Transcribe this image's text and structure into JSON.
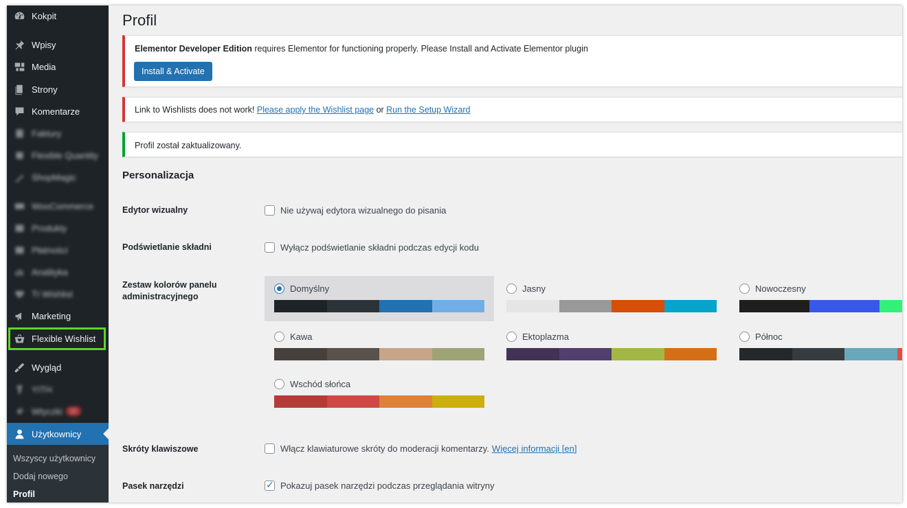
{
  "sidebar": {
    "items": [
      {
        "key": "kokpit",
        "label": "Kokpit",
        "icon": "dashboard-icon",
        "blurred": false
      },
      {
        "key": "wpisy",
        "label": "Wpisy",
        "icon": "pin-icon",
        "blurred": false
      },
      {
        "key": "media",
        "label": "Media",
        "icon": "media-icon",
        "blurred": false
      },
      {
        "key": "strony",
        "label": "Strony",
        "icon": "pages-icon",
        "blurred": false
      },
      {
        "key": "komentarze",
        "label": "Komentarze",
        "icon": "comment-icon",
        "blurred": false
      },
      {
        "key": "faktury",
        "label": "Faktury",
        "icon": "invoice-icon",
        "blurred": true
      },
      {
        "key": "flexible-quantity",
        "label": "Flexible Quantity",
        "icon": "quantity-icon",
        "blurred": true
      },
      {
        "key": "shopmagic",
        "label": "ShopMagic",
        "icon": "magic-icon",
        "blurred": true
      },
      {
        "key": "woocommerce",
        "label": "WooCommerce",
        "icon": "woo-icon",
        "blurred": true
      },
      {
        "key": "produkty",
        "label": "Produkty",
        "icon": "product-icon",
        "blurred": true
      },
      {
        "key": "platnosci",
        "label": "Płatności",
        "icon": "payment-icon",
        "blurred": true
      },
      {
        "key": "analityka",
        "label": "Analityka",
        "icon": "analytics-icon",
        "blurred": true
      },
      {
        "key": "ti-wishlist",
        "label": "TI Wishlist",
        "icon": "heart-icon",
        "blurred": true
      },
      {
        "key": "marketing",
        "label": "Marketing",
        "icon": "megaphone-icon",
        "blurred": false
      },
      {
        "key": "flexible-wishlist",
        "label": "Flexible Wishlist",
        "icon": "basket-heart-icon",
        "blurred": false
      },
      {
        "key": "wyglad",
        "label": "Wygląd",
        "icon": "brush-icon",
        "blurred": false
      },
      {
        "key": "wtyczki-hidden",
        "label": "YITH",
        "icon": "plugin-icon",
        "blurred": true
      },
      {
        "key": "wtyczki",
        "label": "Wtyczki",
        "icon": "plug-icon",
        "blurred": true,
        "badge": "10"
      },
      {
        "key": "uzytkownicy",
        "label": "Użytkownicy",
        "icon": "users-icon",
        "blurred": false,
        "current": true
      }
    ],
    "submenu": [
      "Wszyscy użytkownicy",
      "Dodaj nowego",
      "Profil"
    ]
  },
  "main": {
    "title": "Profil",
    "notice_elementor": {
      "bold": "Elementor Developer Edition",
      "text": " requires Elementor for functioning properly. Please Install and Activate Elementor plugin",
      "button": "Install & Activate"
    },
    "notice_wishlist": {
      "text": "Link to Wishlists does not work! ",
      "link1": "Please apply the Wishlist page",
      "or": " or ",
      "link2": "Run the Setup Wizard"
    },
    "notice_success": "Profil został zaktualizowany.",
    "section_title": "Personalizacja",
    "visual_editor": {
      "label": "Edytor wizualny",
      "option": "Nie używaj edytora wizualnego do pisania",
      "checked": false
    },
    "syntax": {
      "label": "Podświetlanie składni",
      "option": "Wyłącz podświetlanie składni podczas edycji kodu",
      "checked": false
    },
    "color_scheme": {
      "label": "Zestaw kolorów panelu administracyjnego",
      "schemes": [
        {
          "name": "Domyślny",
          "selected": true,
          "colors": [
            "#1d2327",
            "#2c3338",
            "#2271b1",
            "#72aee6"
          ]
        },
        {
          "name": "Jasny",
          "selected": false,
          "colors": [
            "#e5e5e5",
            "#999999",
            "#d64e07",
            "#04a4cc"
          ]
        },
        {
          "name": "Nowoczesny",
          "selected": false,
          "colors": [
            "#1e1e1e",
            "#3858e9",
            "#33f078"
          ]
        },
        {
          "name": "Kawa",
          "selected": false,
          "colors": [
            "#46403c",
            "#59524c",
            "#c7a589",
            "#9ea476"
          ]
        },
        {
          "name": "Ektoplazma",
          "selected": false,
          "colors": [
            "#413256",
            "#523f6d",
            "#a3b745",
            "#d46f15"
          ]
        },
        {
          "name": "Północ",
          "selected": false,
          "colors": [
            "#25282b",
            "#363b3f",
            "#69a8bb",
            "#e14d43"
          ]
        },
        {
          "name": "Wschód słońca",
          "selected": false,
          "colors": [
            "#b43c38",
            "#cf4944",
            "#dd823b",
            "#ccaf0b"
          ]
        }
      ]
    },
    "shortcuts": {
      "label": "Skróty klawiszowe",
      "option": "Włącz klawiaturowe skróty do moderacji komentarzy.",
      "link": "Więcej informacji [en]",
      "checked": false
    },
    "toolbar": {
      "label": "Pasek narzędzi",
      "option": "Pokazuj pasek narzędzi podczas przeglądania witryny",
      "checked": true
    }
  },
  "colors": {
    "accent": "#2271b1",
    "sidebar_bg": "#1d2327",
    "highlight": "#5fd52b",
    "error": "#d63638",
    "success": "#00a32a"
  }
}
